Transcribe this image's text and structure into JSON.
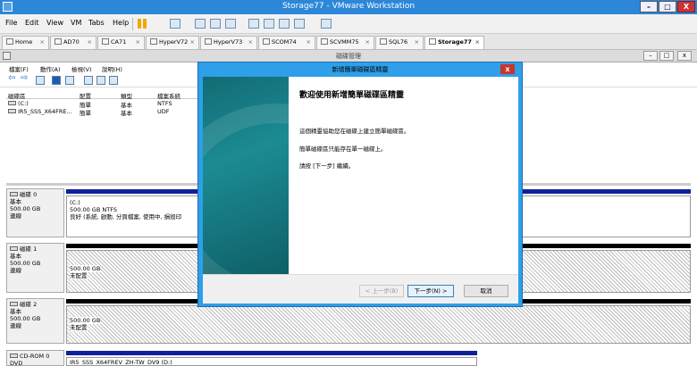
{
  "vmware": {
    "title": "Storage77 - VMware Workstation",
    "window_controls": {
      "minimize": "–",
      "maximize": "□",
      "close": "X"
    },
    "menu": [
      "File",
      "Edit",
      "View",
      "VM",
      "Tabs",
      "Help"
    ],
    "tabs": [
      {
        "label": "Home",
        "close": "×"
      },
      {
        "label": "AD70",
        "close": "×"
      },
      {
        "label": "CA71",
        "close": "×"
      },
      {
        "label": "HyperV72",
        "close": "×"
      },
      {
        "label": "HyperV73",
        "close": "×"
      },
      {
        "label": "SCOM74",
        "close": "×"
      },
      {
        "label": "SCVMM75",
        "close": "×"
      },
      {
        "label": "SQL76",
        "close": "×"
      },
      {
        "label": "Storage77",
        "close": "×"
      }
    ]
  },
  "disk_mgmt": {
    "title": "磁碟管理",
    "window_controls": {
      "minimize": "–",
      "maximize": "□",
      "close": "x"
    },
    "menu": [
      "檔案(F)",
      "動作(A)",
      "檢視(V)",
      "說明(H)"
    ],
    "columns": [
      "磁碟區",
      "配置",
      "類型",
      "檔案系統"
    ],
    "volumes": [
      {
        "name": "(C:)",
        "layout": "簡單",
        "type": "基本",
        "fs": "NTFS"
      },
      {
        "name": "IR5_SSS_X64FRE...",
        "layout": "簡單",
        "type": "基本",
        "fs": "UDF"
      }
    ],
    "disks": [
      {
        "name": "磁碟 0",
        "type": "基本",
        "size": "500.00 GB",
        "status": "連線",
        "vol_name": "(C:)",
        "vol_size": "500.00 GB NTFS",
        "vol_status": "良好 (系統, 啟動, 分頁檔案, 使用中, 損毀印"
      },
      {
        "name": "磁碟 1",
        "type": "基本",
        "size": "500.00 GB",
        "status": "連線",
        "vol_size": "500.00 GB",
        "vol_status": "未配置"
      },
      {
        "name": "磁碟 2",
        "type": "基本",
        "size": "500.00 GB",
        "status": "連線",
        "vol_size": "500.00 GB",
        "vol_status": "未配置"
      },
      {
        "name": "CD-ROM 0",
        "type": "DVD",
        "vol_name": "IR5_SSS_X64FREV_ZH-TW_DV9 (D:)"
      }
    ]
  },
  "wizard": {
    "title": "新增簡單磁碟區精靈",
    "close": "x",
    "heading": "歡迎使用新增簡單磁碟區精靈",
    "lines": [
      "這個精靈協助您在磁碟上建立簡單磁碟區。",
      "簡單磁碟區只能存在單一磁碟上。",
      "請按 [下一步] 繼續。"
    ],
    "buttons": {
      "back": "< 上一步(B)",
      "next": "下一步(N) >",
      "cancel": "取消"
    }
  }
}
